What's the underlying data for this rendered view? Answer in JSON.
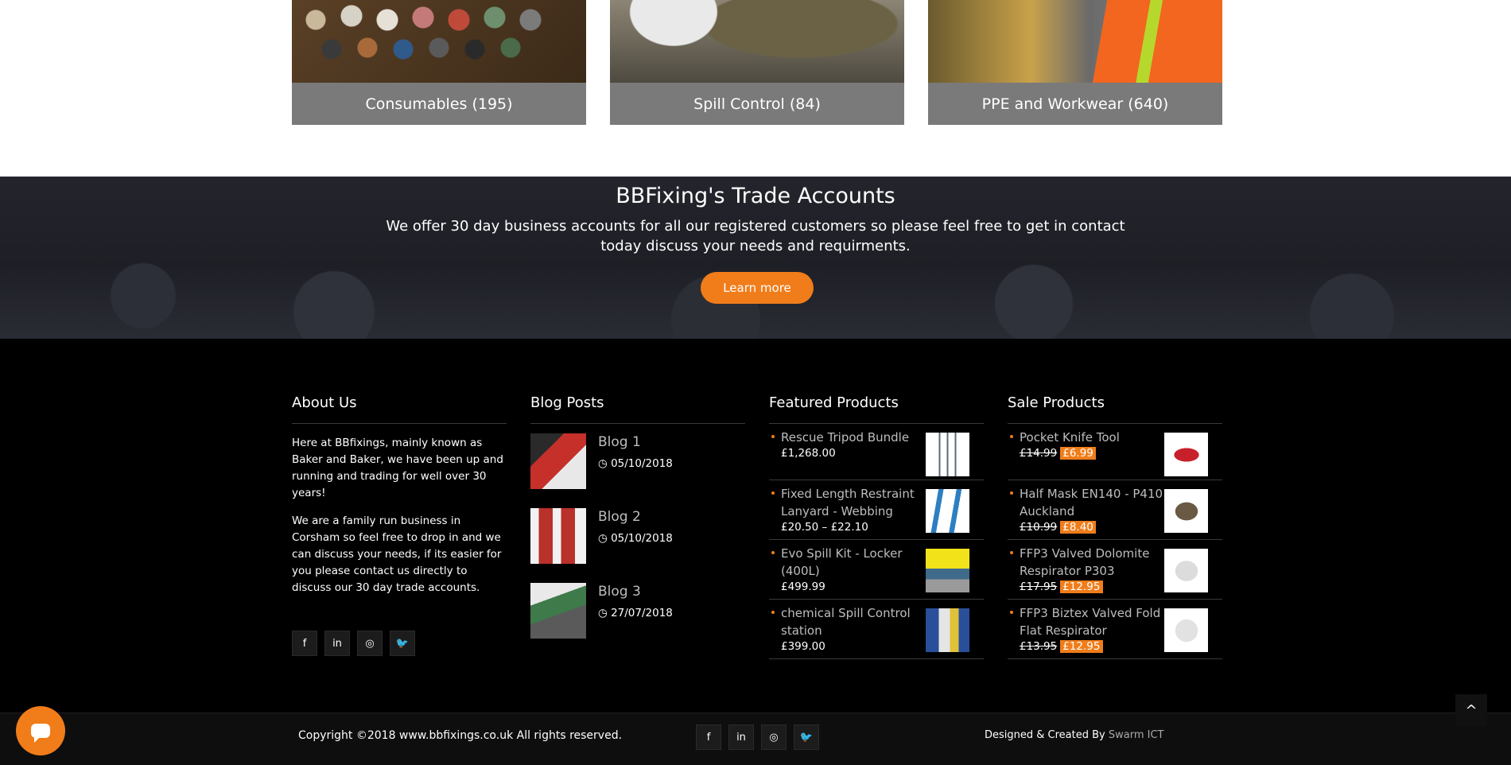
{
  "categories": [
    {
      "label": "Consumables (195)"
    },
    {
      "label": "Spill Control (84)"
    },
    {
      "label": "PPE and Workwear (640)"
    }
  ],
  "trade": {
    "title": "BBFixing's Trade Accounts",
    "text": "We offer 30 day business accounts for all our registered customers so please feel free to get in contact today discuss your needs and requirments.",
    "button": "Learn more"
  },
  "about": {
    "title": "About Us",
    "p1": "Here at BBfixings, mainly known as Baker and Baker, we have been up and running and trading for well over 30 years!",
    "p2": "We are a family run business in Corsham so feel free to drop in and we can discuss your needs, if its easier for you please contact us directly to discuss our 30 day trade accounts."
  },
  "blog": {
    "title": "Blog Posts",
    "posts": [
      {
        "title": "Blog 1",
        "date": "05/10/2018"
      },
      {
        "title": "Blog 2",
        "date": "05/10/2018"
      },
      {
        "title": "Blog 3",
        "date": "27/07/2018"
      }
    ]
  },
  "featured": {
    "title": "Featured Products",
    "items": [
      {
        "name": "Rescue Tripod Bundle",
        "price": "£1,268.00"
      },
      {
        "name": "Fixed Length Restraint Lanyard - Webbing",
        "price": "£20.50 – £22.10"
      },
      {
        "name": "Evo Spill Kit - Locker (400L)",
        "price": "£499.99"
      },
      {
        "name": "chemical Spill Control station",
        "price": "£399.00"
      }
    ]
  },
  "sale": {
    "title": "Sale Products",
    "items": [
      {
        "name": "Pocket Knife Tool",
        "old": "£14.99",
        "new": "£6.99"
      },
      {
        "name": "Half Mask EN140 - P410 Auckland",
        "old": "£10.99",
        "new": "£8.40"
      },
      {
        "name": "FFP3 Valved Dolomite Respirator P303",
        "old": "£17.95",
        "new": "£12.95"
      },
      {
        "name": "FFP3 Biztex Valved Fold Flat Respirator",
        "old": "£13.95",
        "new": "£12.95"
      }
    ]
  },
  "bottom": {
    "copyright": "Copyright ©2018 www.bbfixings.co.uk All rights reserved.",
    "credit_prefix": "Designed & Created By",
    "credit_link": "Swarm ICT"
  },
  "icons": {
    "facebook": "f",
    "linkedin": "in",
    "instagram": "◎",
    "twitter": "🐦",
    "clock": "◷",
    "up": "^"
  },
  "colors": {
    "accent": "#f07d1a"
  }
}
